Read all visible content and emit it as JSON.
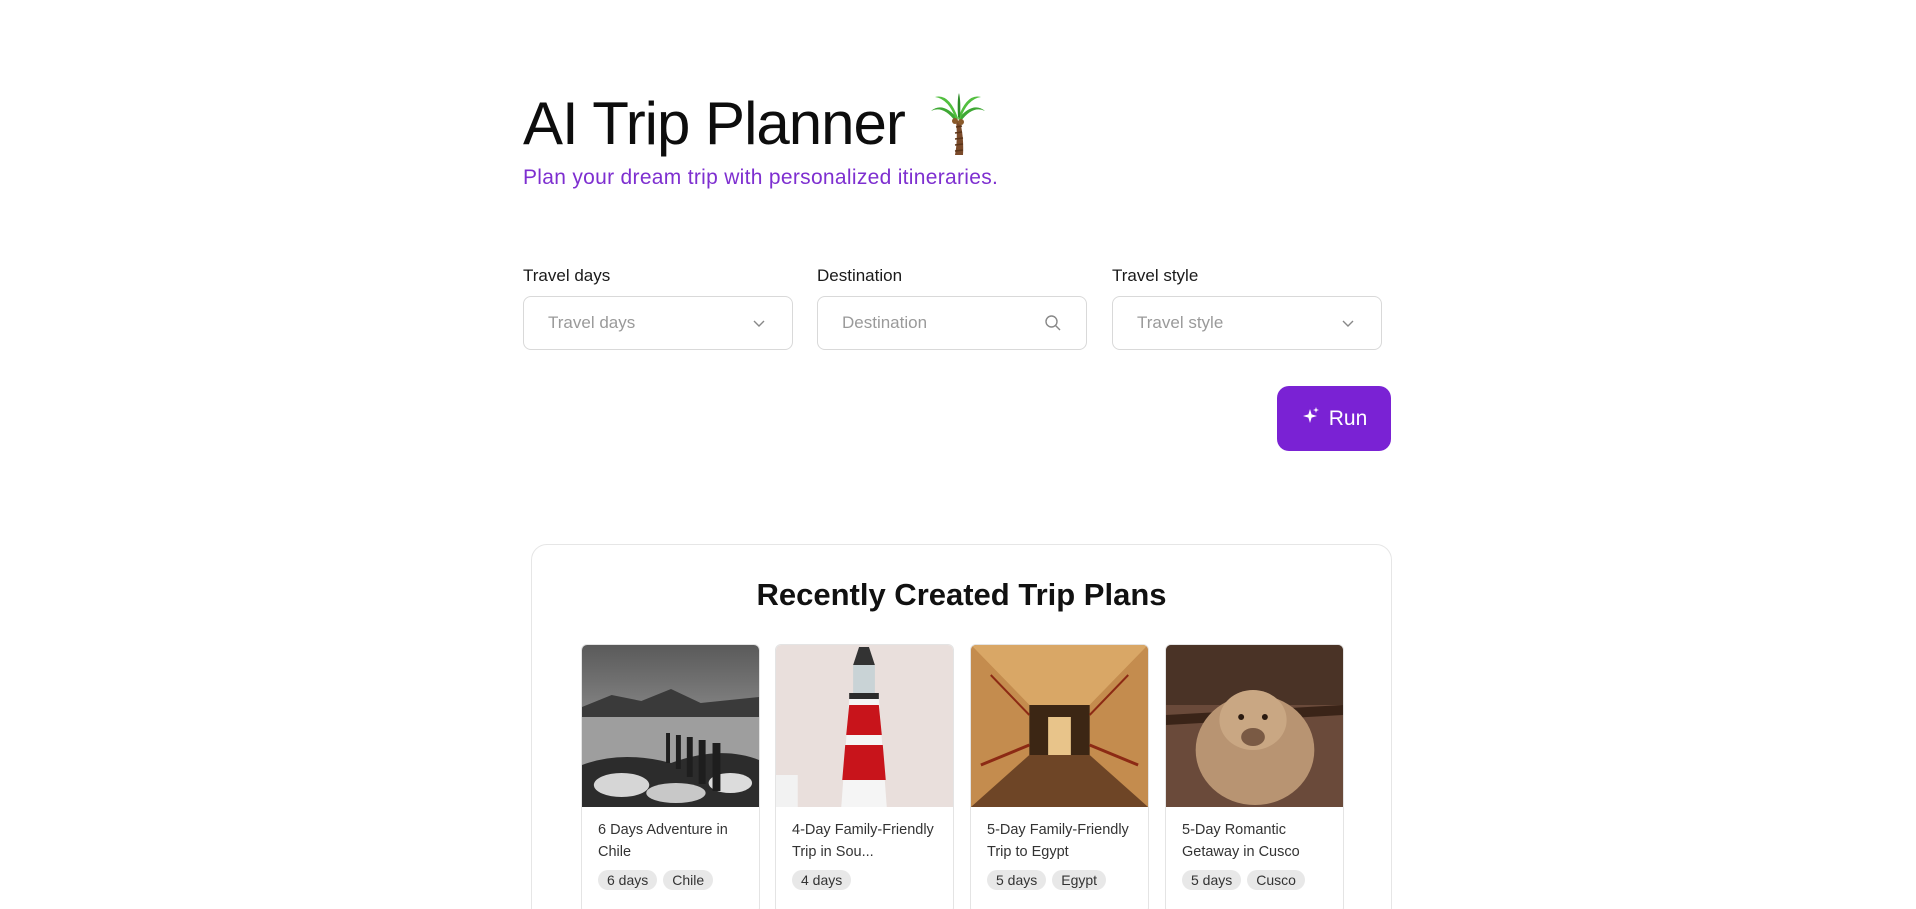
{
  "header": {
    "title": "AI Trip Planner",
    "title_emoji_icon": "palm-tree-icon",
    "subtitle": "Plan your dream trip with personalized itineraries."
  },
  "form": {
    "travel_days": {
      "label": "Travel days",
      "placeholder": "Travel days",
      "icon": "chevron-down-icon"
    },
    "destination": {
      "label": "Destination",
      "placeholder": "Destination",
      "icon": "search-icon"
    },
    "travel_style": {
      "label": "Travel style",
      "placeholder": "Travel style",
      "icon": "chevron-down-icon"
    },
    "run_button": {
      "label": "Run",
      "icon": "sparkle-icon"
    }
  },
  "recent": {
    "title": "Recently Created Trip Plans",
    "cards": [
      {
        "title": "6 Days Adventure in Chile",
        "tags": [
          "6 days",
          "Chile"
        ]
      },
      {
        "title": "4-Day Family-Friendly Trip in Sou...",
        "tags": [
          "4 days"
        ]
      },
      {
        "title": "5-Day Family-Friendly Trip to Egypt",
        "tags": [
          "5 days",
          "Egypt"
        ]
      },
      {
        "title": "5-Day Romantic Getaway in Cusco",
        "tags": [
          "5 days",
          "Cusco"
        ]
      }
    ]
  },
  "colors": {
    "accent": "#7a22d4",
    "subtitle": "#7e2fd0",
    "border": "#d9d9d9"
  }
}
